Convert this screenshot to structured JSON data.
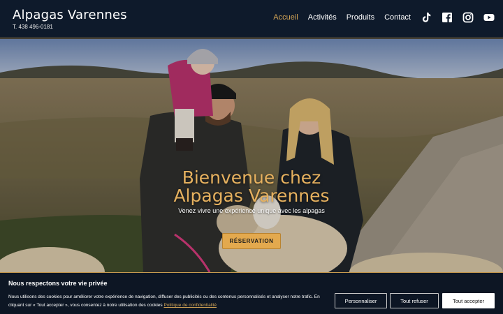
{
  "header": {
    "brand": "Alpagas Varennes",
    "phone": "T. 438 496-0181",
    "nav": [
      {
        "label": "Accueil",
        "active": true
      },
      {
        "label": "Activités",
        "active": false
      },
      {
        "label": "Produits",
        "active": false
      },
      {
        "label": "Contact",
        "active": false
      }
    ],
    "social_icons": [
      "tiktok-icon",
      "facebook-icon",
      "instagram-icon",
      "youtube-icon"
    ],
    "accent_color": "#d4a556"
  },
  "hero": {
    "title_line1": "Bienvenue chez",
    "title_line2": "Alpagas Varennes",
    "subtitle": "Venez vivre une expérience unique avec les alpagas",
    "cta": "RÉSERVATION"
  },
  "cookie_banner": {
    "title": "Nous respectons votre vie privée",
    "text": "Nous utilisons des cookies pour améliorer votre expérience de navigation, diffuser des publicités ou des contenus personnalisés et analyser notre trafic. En cliquant sur « Tout accepter », vous consentez à notre utilisation des cookies",
    "policy_link": "Politique de confidentialité",
    "buttons": {
      "customize": "Personnaliser",
      "refuse": "Tout refuser",
      "accept": "Tout accepter"
    }
  }
}
